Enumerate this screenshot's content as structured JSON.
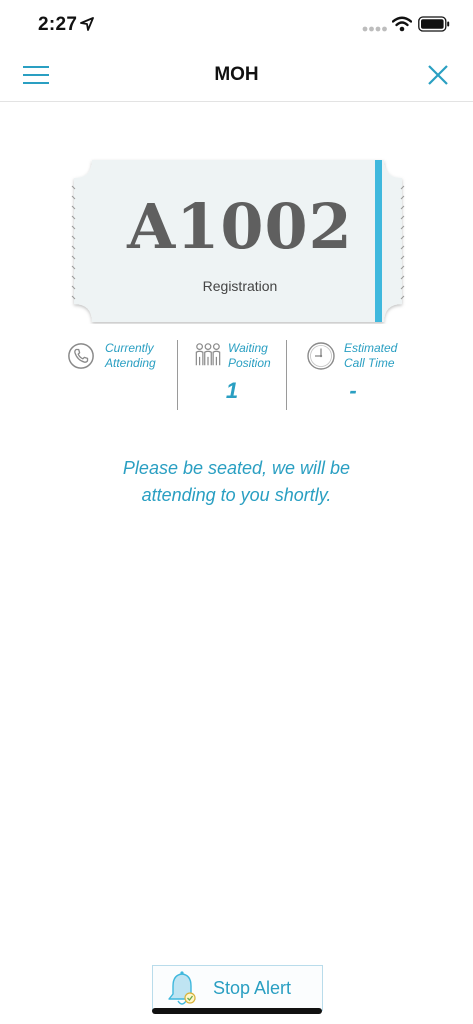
{
  "status_bar": {
    "time": "2:27"
  },
  "nav": {
    "title": "MOH"
  },
  "ticket": {
    "number": "A1002",
    "service": "Registration"
  },
  "info": {
    "currently_attending": {
      "line1": "Currently",
      "line2": "Attending",
      "value": ""
    },
    "waiting_position": {
      "line1": "Waiting",
      "line2": "Position",
      "value": "1"
    },
    "estimated_call_time": {
      "line1": "Estimated",
      "line2": "Call Time",
      "value": "-"
    }
  },
  "message": {
    "line1": "Please be seated, we will be",
    "line2": "attending to you shortly."
  },
  "stop_alert": {
    "label": "Stop Alert"
  },
  "colors": {
    "accent": "#2a9fc2",
    "ticket_bg": "#eef3f4",
    "ticket_stripe": "#3fb8dd",
    "ticket_text": "#5f5f5f"
  },
  "icons": [
    "location-arrow-icon",
    "signal-icon",
    "wifi-icon",
    "battery-icon",
    "menu-icon",
    "close-icon",
    "phone-icon",
    "people-icon",
    "clock-icon",
    "bell-icon"
  ]
}
